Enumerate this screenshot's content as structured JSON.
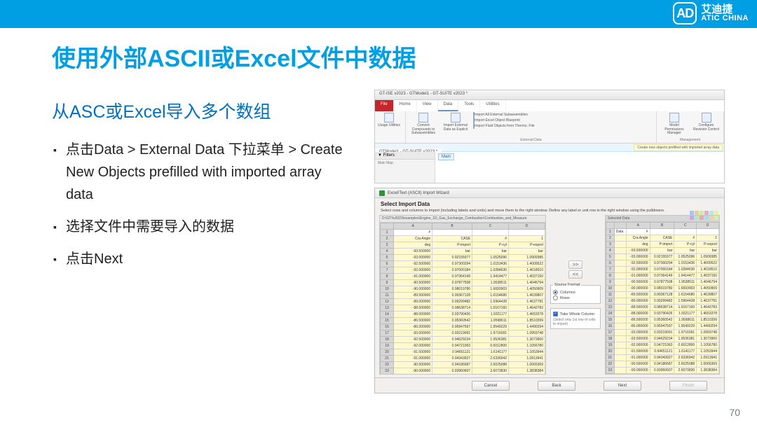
{
  "header": {
    "logo_cn": "艾迪捷",
    "logo_en": "ATIC CHINA",
    "logo_mark": "AD"
  },
  "slide": {
    "title": "使用外部ASCII或Excel文件中数据",
    "subtitle": "从ASC或Excel导入多个数组",
    "bullets": [
      "点击Data > External Data 下拉菜单 > Create New Objects prefilled with imported array data",
      "选择文件中需要导入的数据",
      "点击Next"
    ],
    "page": "70"
  },
  "app": {
    "window_title": "GT-ISE v2023 - GTModel1 - GT-SUITE v2023 *",
    "tabs": [
      "File",
      "Home",
      "View",
      "Data",
      "Tools",
      "Utilities"
    ],
    "ribbon_groups": {
      "usage": {
        "btn": "Usage Utilities",
        "label": ""
      },
      "external": {
        "convert": "Convert Compounds\nto Subassemblies",
        "import_explicit": "Import External\nData as Explicit",
        "import_sub": "Import All External Subassemblies",
        "import_blueprint": "Import Excel Object Blueprint",
        "import_fluid": "Import Fluid Objects from Thermo. File",
        "label": "External Data"
      },
      "mgmt": {
        "perm": "Model Permissions\nManager",
        "rev": "Configure\nRevision Control",
        "label": "Management"
      }
    },
    "status_hint": "Create new objects prefilled with imported array data",
    "model_tab": "GTModel1 - GT-SUITE v2023 *",
    "filters_hd": "▼ Filters",
    "nav_tab": "Main Map",
    "canvas_tab": "Main"
  },
  "wizard": {
    "title": "Excel/Text (ASCII) Import Wizard",
    "heading": "Select Import Data",
    "subtext": "Select rows and columns to import (including labels and units) and move them to the right window.\nDefine any label or unit row in the right window using the pulldowns.",
    "left_path": "D:\\GTI\\v2023\\examples\\Engine_1D_Gas_Exchange_Combustion\\Combustion_and_Measure",
    "left_cols": [
      "",
      "A",
      "B",
      "C",
      "D"
    ],
    "right_hdr": "Selected Data",
    "right_cols": [
      "",
      "",
      "A",
      "B",
      "C",
      "D"
    ],
    "rows": [
      {
        "n": "1",
        "a": "#",
        "b": "",
        "c": "",
        "d": "",
        "data_lbl": "Data"
      },
      {
        "n": "2",
        "a": "Cra Angle",
        "b": "CASE",
        "c": "#",
        "d": "1",
        "extra": "=1"
      },
      {
        "n": "3",
        "a": "deg",
        "b": "P-import",
        "c": "P-cyl",
        "d": "P-export"
      },
      {
        "n": "4",
        "a": "-93.500000",
        "b": "bar",
        "c": "bar",
        "d": "bar"
      },
      {
        "n": "5",
        "a": "-93.000000",
        "b": "0.92155977",
        "c": "1.0525096",
        "d": "1.0909385"
      },
      {
        "n": "6",
        "a": "-92.500000",
        "b": "0.97300294",
        "c": "1.0153436",
        "d": "1.4009522"
      },
      {
        "n": "7",
        "a": "-92.000000",
        "b": "0.97000184",
        "c": "1.0284630",
        "d": "1.4018510"
      },
      {
        "n": "8",
        "a": "-91.000000",
        "b": "0.97364149",
        "c": "1.9414477",
        "d": "1.4037150"
      },
      {
        "n": "9",
        "a": "-90.500000",
        "b": "0.97877508",
        "c": "1.9538511",
        "d": "1.4046794"
      },
      {
        "n": "10",
        "a": "-90.000000",
        "b": "0.98019780",
        "c": "1.6693903",
        "d": "1.4050909"
      },
      {
        "n": "11",
        "a": "-89.500000",
        "b": "0.99367128",
        "c": "1.6154680",
        "d": "1.4639807"
      },
      {
        "n": "12",
        "a": "-89.000000",
        "b": "0.99299482",
        "c": "1.5964428",
        "d": "1.4637781"
      },
      {
        "n": "13",
        "a": "-88.500000",
        "b": "0.98638714",
        "c": "1.9167160",
        "d": "1.4642783"
      },
      {
        "n": "14",
        "a": "-88.000000",
        "b": "0.93790426",
        "c": "1.9321177",
        "d": "1.4653378"
      },
      {
        "n": "15",
        "a": "-86.500000",
        "b": "0.95360542",
        "c": "1.9598611",
        "d": "1.8510399"
      },
      {
        "n": "16",
        "a": "-86.000000",
        "b": "0.95947597",
        "c": "1.9549229",
        "d": "1.4490294"
      },
      {
        "n": "17",
        "a": "-93.000000",
        "b": "0.93219091",
        "c": "1.9716091",
        "d": "1.0959748"
      },
      {
        "n": "18",
        "a": "-92.500000",
        "b": "0.94629234",
        "c": "1.9536381",
        "d": "1.3073900"
      },
      {
        "n": "19",
        "a": "-92.000000",
        "b": "0.94721063",
        "c": "0.6012800",
        "d": "1.1056780"
      },
      {
        "n": "20",
        "a": "-91.500000",
        "b": "0.94651121",
        "c": "1.6141177",
        "d": "1.1053944"
      },
      {
        "n": "21",
        "a": "-91.000000",
        "b": "0.94343927",
        "c": "2.6336942",
        "d": "1.0913941"
      },
      {
        "n": "22",
        "a": "-90.500000",
        "b": "0.94186687",
        "c": "2.6025088",
        "d": "1.0065369"
      },
      {
        "n": "23",
        "a": "-90.000000",
        "b": "0.93960607",
        "c": "2.6073830",
        "d": "1.3838384"
      }
    ],
    "mid": {
      "source_format": "Source Format",
      "columns": "Columns",
      "rows": "Rows",
      "take_label": "Take Whole Column",
      "take_help": "(Select only 1st row of cells to import)"
    },
    "buttons": {
      "cancel": "Cancel",
      "back": "Back",
      "next": "Next",
      "finish": "Finish"
    }
  },
  "chip_colors": [
    "#a6c8f0",
    "#f0c8a6",
    "#c8f0a6",
    "#f0a6c8",
    "#a6f0e8",
    "#f0eea6",
    "#c8a6f0",
    "#a6f0c8",
    "#f0a6a6",
    "#a6dcf0",
    "#f0d2a6",
    "#d2f0a6"
  ]
}
